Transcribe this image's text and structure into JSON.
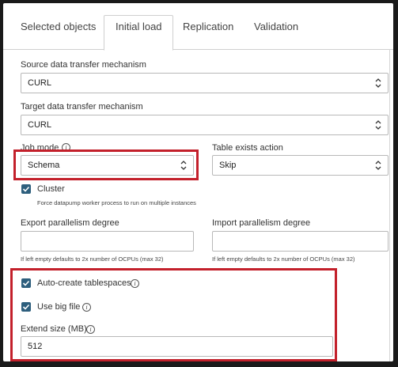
{
  "tabs": [
    {
      "label": "Selected objects"
    },
    {
      "label": "Initial load"
    },
    {
      "label": "Replication"
    },
    {
      "label": "Validation"
    }
  ],
  "source_mechanism": {
    "label": "Source data transfer mechanism",
    "value": "CURL"
  },
  "target_mechanism": {
    "label": "Target data transfer mechanism",
    "value": "CURL"
  },
  "job_mode": {
    "label": "Job mode",
    "value": "Schema"
  },
  "table_exists": {
    "label": "Table exists action",
    "value": "Skip"
  },
  "cluster": {
    "label": "Cluster",
    "hint": "Force datapump worker process to run on multiple instances"
  },
  "export_parallelism": {
    "label": "Export parallelism degree",
    "value": "",
    "hint": "If left empty defaults to 2x number of OCPUs (max 32)"
  },
  "import_parallelism": {
    "label": "Import parallelism degree",
    "value": "",
    "hint": "If left empty defaults to 2x number of OCPUs (max 32)"
  },
  "auto_create": {
    "label": "Auto-create tablespaces"
  },
  "big_file": {
    "label": "Use big file"
  },
  "extend_size": {
    "label": "Extend size (MB)",
    "value": "512"
  },
  "info_glyph": "i",
  "colors": {
    "highlight": "#c3202b",
    "checkbox": "#2e5f7d"
  }
}
